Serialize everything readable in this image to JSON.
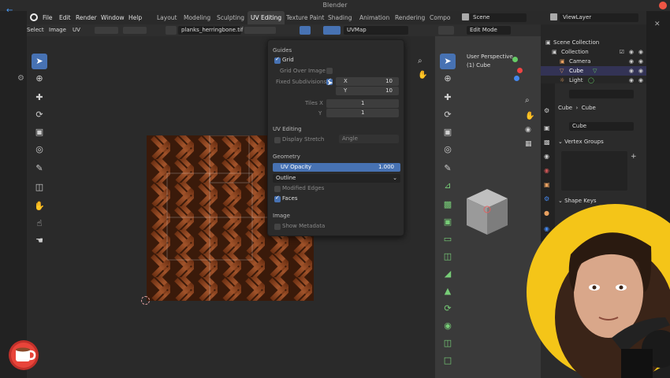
{
  "window": {
    "title": "Blender"
  },
  "menubar": {
    "menus": [
      "File",
      "Edit",
      "Render",
      "Window",
      "Help"
    ],
    "workspaces": [
      "Layout",
      "Modeling",
      "Sculpting",
      "UV Editing",
      "Texture Paint",
      "Shading",
      "Animation",
      "Rendering",
      "Compo"
    ],
    "active_workspace": "UV Editing",
    "scene_label": "Scene",
    "viewlayer_label": "ViewLayer"
  },
  "uv_header": {
    "select": "Select",
    "image": "Image",
    "uv": "UV",
    "image_name": "planks_herringbone.tif",
    "uvmap": "UVMap"
  },
  "overlay_popover": {
    "guides_heading": "Guides",
    "grid_label": "Grid",
    "grid_over_image_label": "Grid Over Image",
    "fixed_subdivisions_label": "Fixed Subdivisions",
    "x_label": "X",
    "x_value": "10",
    "y_label": "Y",
    "y_value": "10",
    "tiles_x_label": "Tiles X",
    "tiles_x_value": "1",
    "tiles_y_label": "Y",
    "tiles_y_value": "1",
    "uv_editing_heading": "UV Editing",
    "display_stretch_label": "Display Stretch",
    "stretch_mode": "Angle",
    "geometry_heading": "Geometry",
    "uv_opacity_label": "UV Opacity",
    "uv_opacity_value": "1.000",
    "edge_display": "Outline",
    "modified_edges_label": "Modified Edges",
    "faces_label": "Faces",
    "image_heading": "Image",
    "show_metadata_label": "Show Metadata",
    "grid_checked": true,
    "fixed_subdivisions_checked": true,
    "faces_checked": true
  },
  "viewport3d": {
    "mode": "Edit Mode",
    "view_label": "User Perspective",
    "object_label": "(1) Cube"
  },
  "outliner": {
    "rows": [
      "Scene Collection",
      "Collection",
      "Camera",
      "Cube",
      "Light"
    ]
  },
  "properties": {
    "object_path": "Cube",
    "mesh_name": "Cube",
    "data_name": "Cube",
    "vertex_groups_label": "Vertex Groups",
    "shape_keys_label": "Shape Keys"
  },
  "colors": {
    "accent": "#4772b3",
    "header_bg": "#2e2e2e",
    "editor_bg": "#2a2a2a"
  }
}
